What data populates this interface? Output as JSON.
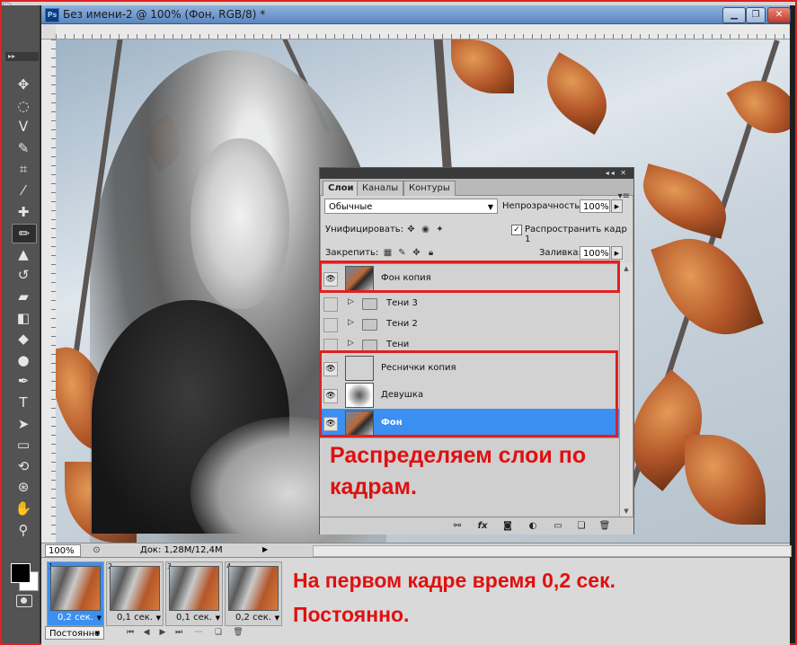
{
  "app": {
    "badge": "PS"
  },
  "document": {
    "title": "Без имени-2 @ 100% (Фон, RGB/8) *",
    "ps_icon": "Ps",
    "window_buttons": [
      "minimize-icon",
      "restore-icon",
      "close-icon"
    ]
  },
  "toolbox": {
    "collapse_label": "▸▸",
    "tools": [
      {
        "name": "move-tool-icon",
        "glyph": "✥"
      },
      {
        "name": "marquee-tool-icon",
        "glyph": "◌"
      },
      {
        "name": "lasso-tool-icon",
        "glyph": "ᐯ"
      },
      {
        "name": "quick-selection-icon",
        "glyph": "✎"
      },
      {
        "name": "crop-tool-icon",
        "glyph": "⌗"
      },
      {
        "name": "eyedropper-icon",
        "glyph": "⁄"
      },
      {
        "name": "healing-brush-icon",
        "glyph": "✚"
      },
      {
        "name": "brush-tool-icon",
        "glyph": "✏"
      },
      {
        "name": "clone-stamp-icon",
        "glyph": "▲"
      },
      {
        "name": "history-brush-icon",
        "glyph": "↺"
      },
      {
        "name": "eraser-tool-icon",
        "glyph": "▰"
      },
      {
        "name": "gradient-tool-icon",
        "glyph": "◧"
      },
      {
        "name": "blur-tool-icon",
        "glyph": "◆"
      },
      {
        "name": "dodge-tool-icon",
        "glyph": "●"
      },
      {
        "name": "pen-tool-icon",
        "glyph": "✒"
      },
      {
        "name": "type-tool-icon",
        "glyph": "T"
      },
      {
        "name": "path-selection-icon",
        "glyph": "➤"
      },
      {
        "name": "shape-tool-icon",
        "glyph": "▭"
      },
      {
        "name": "3d-rotate-icon",
        "glyph": "⟲"
      },
      {
        "name": "3d-orbit-icon",
        "glyph": "⊛"
      },
      {
        "name": "hand-tool-icon",
        "glyph": "✋"
      },
      {
        "name": "zoom-tool-icon",
        "glyph": "⚲"
      }
    ]
  },
  "layers_panel": {
    "panel_buttons": "◂◂ ✕",
    "tabs": [
      "Слои",
      "Каналы",
      "Контуры"
    ],
    "menu_icon": "▾≡",
    "blend_mode": "Обычные",
    "opacity_label": "Непрозрачность:",
    "opacity_value": "100%",
    "unify_label": "Унифицировать:",
    "propagate_label": "Распространить кадр 1",
    "lock_label": "Закрепить:",
    "fill_label": "Заливка:",
    "fill_value": "100%",
    "layers": [
      {
        "name": "Фон копия",
        "visible": true,
        "type": "photo",
        "selected": false
      },
      {
        "name": "Тени 3",
        "visible": false,
        "type": "group",
        "selected": false
      },
      {
        "name": "Тени 2",
        "visible": false,
        "type": "group",
        "selected": false
      },
      {
        "name": "Тени",
        "visible": false,
        "type": "group",
        "selected": false
      },
      {
        "name": "Реснички копия",
        "visible": true,
        "type": "transparent",
        "selected": false
      },
      {
        "name": "Девушка",
        "visible": true,
        "type": "girl",
        "selected": false
      },
      {
        "name": "Фон",
        "visible": true,
        "type": "photo",
        "selected": true
      }
    ],
    "footer_icons": [
      "link-layers-icon",
      "fx-icon",
      "layer-mask-icon",
      "adjustment-layer-icon",
      "new-group-icon",
      "new-layer-icon",
      "trash-icon"
    ]
  },
  "annotations": {
    "layers_note": "Распределяем слои по кадрам.",
    "frame_note": "На первом кадре время 0,2 сек. Постоянно."
  },
  "status_bar": {
    "zoom": "100%",
    "doc_size": "Док: 1,28M/12,4M",
    "arrow": "▶"
  },
  "animation": {
    "frames": [
      {
        "num": "1",
        "time": "0,2 сек.",
        "selected": true
      },
      {
        "num": "2",
        "time": "0,1 сек.",
        "selected": false
      },
      {
        "num": "3",
        "time": "0,1 сек.",
        "selected": false
      },
      {
        "num": "4",
        "time": "0,2 сек.",
        "selected": false
      }
    ],
    "loop": "Постоянно",
    "controls": [
      "first-frame-icon",
      "prev-frame-icon",
      "play-icon",
      "next-frame-icon",
      "tween-icon",
      "duplicate-frame-icon",
      "delete-frame-icon"
    ]
  },
  "colors": {
    "selection_blue": "#3b8ff0",
    "annotation_red": "#e01010",
    "panel_gray": "#d6d6d6"
  }
}
